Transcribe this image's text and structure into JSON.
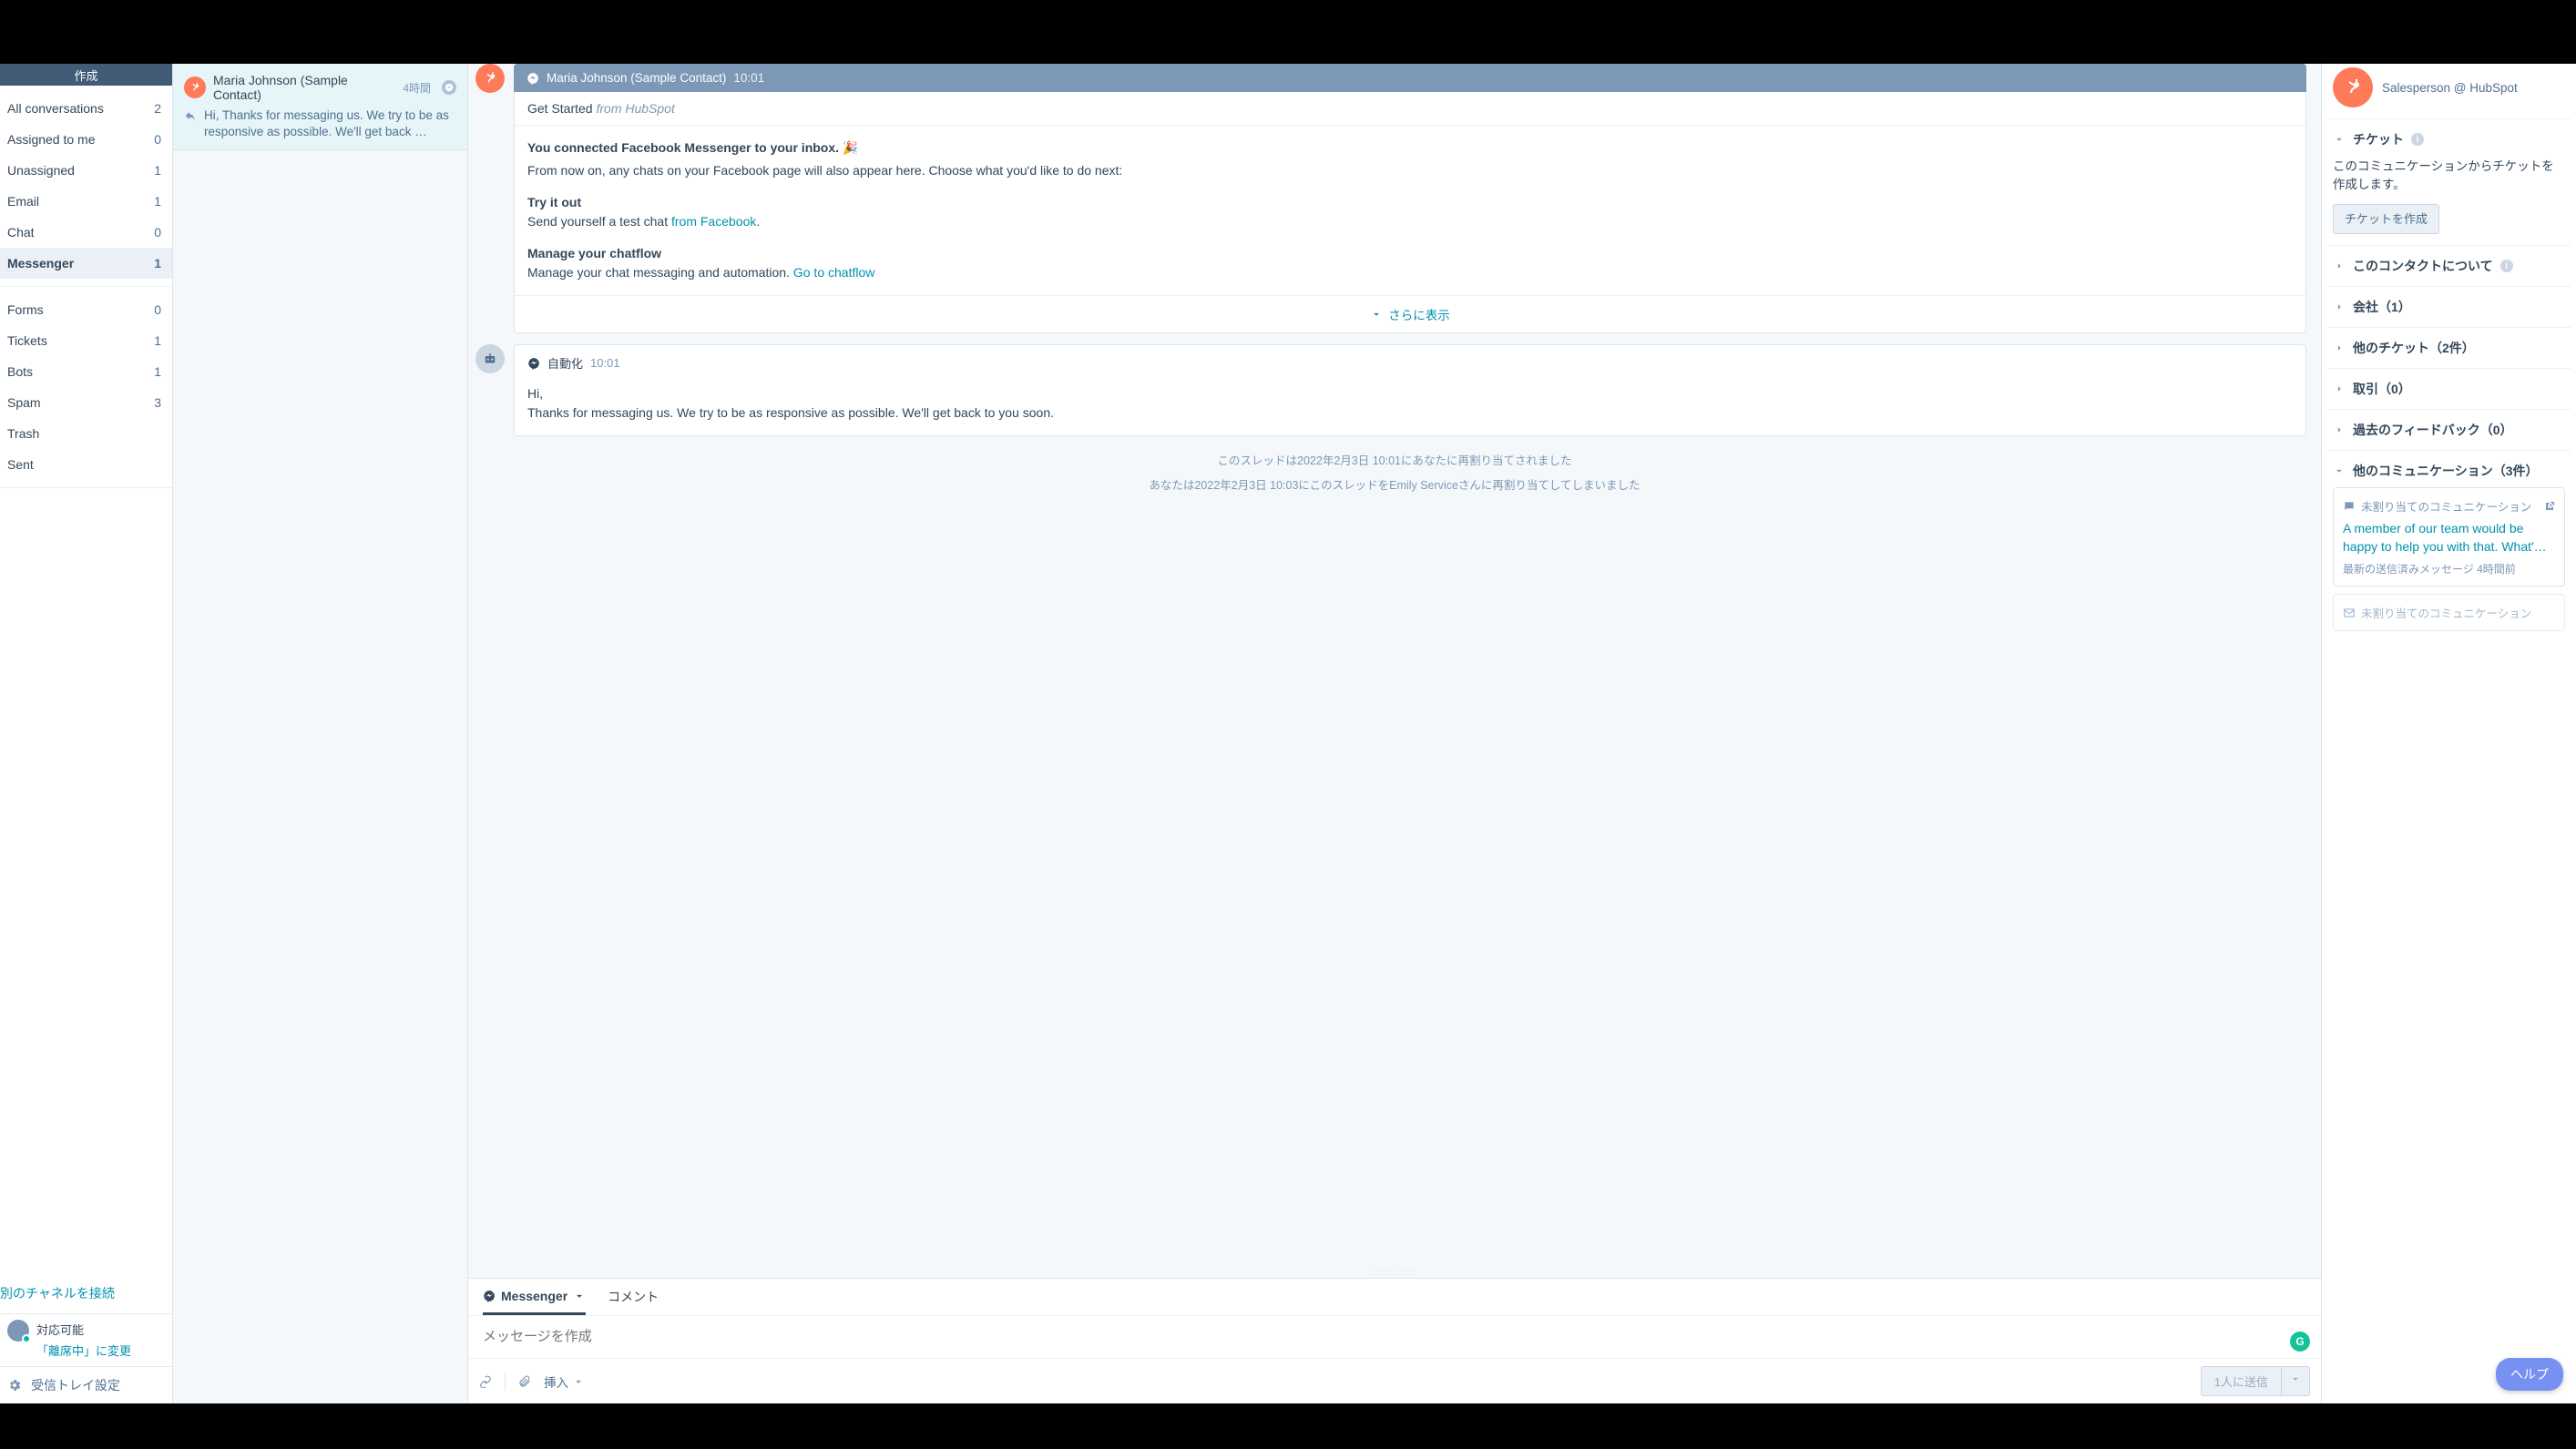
{
  "compose": "作成",
  "nav_main": [
    {
      "label": "All conversations",
      "count": "2"
    },
    {
      "label": "Assigned to me",
      "count": "0"
    },
    {
      "label": "Unassigned",
      "count": "1"
    },
    {
      "label": "Email",
      "count": "1"
    },
    {
      "label": "Chat",
      "count": "0"
    },
    {
      "label": "Messenger",
      "count": "1"
    }
  ],
  "nav_secondary": [
    {
      "label": "Forms",
      "count": "0"
    },
    {
      "label": "Tickets",
      "count": "1"
    },
    {
      "label": "Bots",
      "count": "1"
    },
    {
      "label": "Spam",
      "count": "3"
    },
    {
      "label": "Trash",
      "count": ""
    },
    {
      "label": "Sent",
      "count": ""
    }
  ],
  "connect_channel": "別のチャネルを接続",
  "status_available": "対応可能",
  "status_change_away": "「離席中」に変更",
  "inbox_settings": "受信トレイ設定",
  "convo": {
    "name": "Maria Johnson (Sample Contact)",
    "time": "4時間",
    "preview": "Hi, Thanks for messaging us. We try to be as responsive as possible. We'll get back …"
  },
  "thread_header": {
    "name": "Maria Johnson (Sample Contact)",
    "time": "10:01"
  },
  "subject": {
    "title": "Get Started ",
    "from": "from HubSpot"
  },
  "msg1": {
    "connected": "You connected Facebook Messenger to your inbox. 🎉",
    "from_now": "From now on, any chats on your Facebook page will also appear here. Choose what you'd like to do next:",
    "try_h": "Try it out",
    "try_t": "Send yourself a test chat ",
    "try_link": "from Facebook",
    "manage_h": "Manage your chatflow",
    "manage_t": "Manage your chat messaging and automation. ",
    "manage_link": "Go to chatflow",
    "show_more": "さらに表示"
  },
  "msg2": {
    "sender": "自動化",
    "time": "10:01",
    "l1": "Hi,",
    "l2": "Thanks for messaging us. We try to be as responsive as possible. We'll get back to you soon."
  },
  "sys1": "このスレッドは2022年2月3日 10:01にあなたに再割り当てされました",
  "sys2": "あなたは2022年2月3日 10:03にこのスレッドをEmily Serviceさんに再割り当てしてしまいました",
  "composer": {
    "tab1": "Messenger",
    "tab2": "コメント",
    "placeholder": "メッセージを作成",
    "insert": "挿入",
    "send": "1人に送信"
  },
  "right": {
    "subtitle": "Salesperson @ HubSpot",
    "ticket_h": "チケット",
    "ticket_body": "このコミュニケーションからチケットを作成します。",
    "ticket_btn": "チケットを作成",
    "about": "このコンタクトについて",
    "company": "会社（1）",
    "other_tickets": "他のチケット（2件）",
    "deals": "取引（0）",
    "feedback": "過去のフィードバック（0）",
    "other_comm": "他のコミュニケーション（3件）",
    "comm_card_title": "未割り当てのコミュニケーション",
    "comm_card_body": "A member of our team would be happy to help you with that. What'…",
    "comm_card_meta": "最新の送信済みメッセージ 4時間前",
    "comm_card2_title": "未割り当てのコミュニケーション"
  },
  "help": "ヘルプ"
}
